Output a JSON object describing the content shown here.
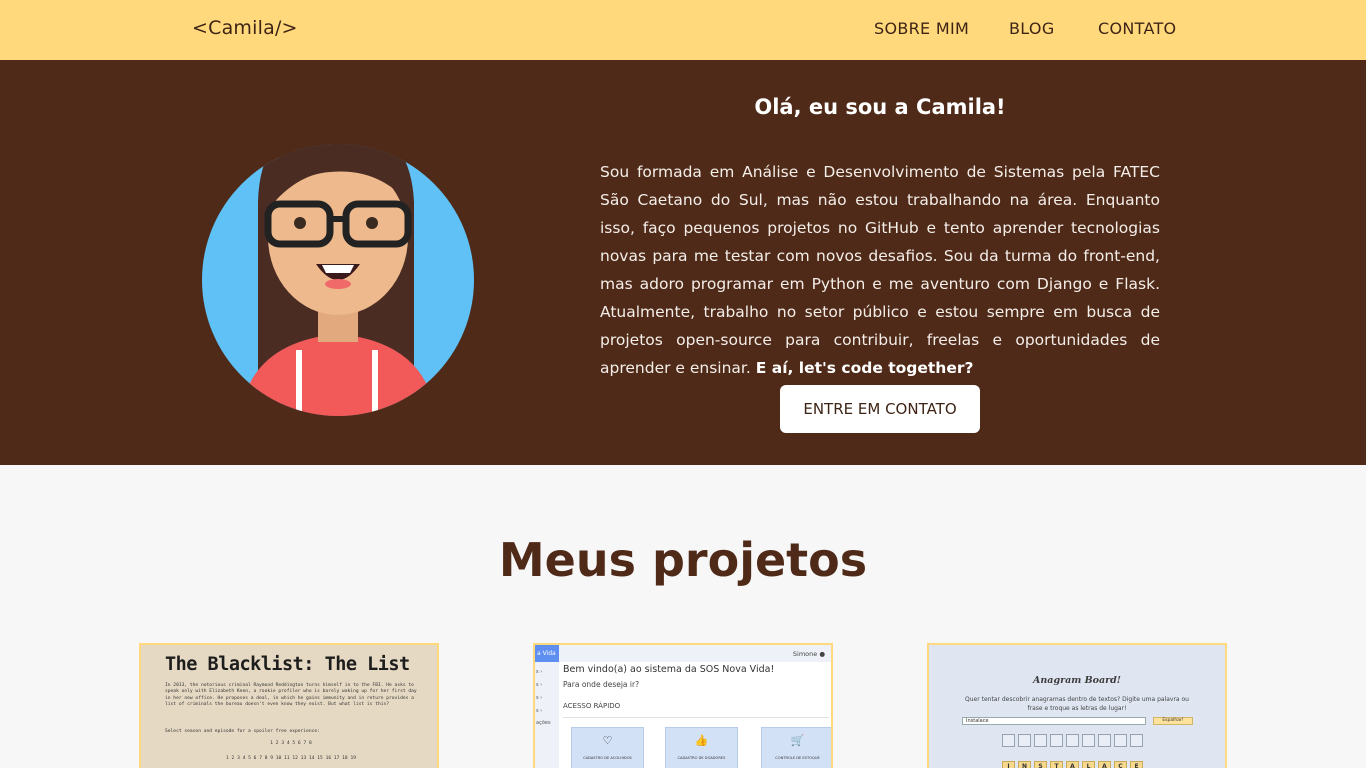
{
  "header": {
    "logo": "<Camila/>",
    "nav": [
      "SOBRE MIM",
      "BLOG",
      "CONTATO"
    ]
  },
  "hero": {
    "title": "Olá, eu sou a Camila!",
    "paragraph": "Sou formada em Análise e Desenvolvimento de Sistemas pela FATEC São Caetano do Sul, mas não estou trabalhando na área. Enquanto isso, faço pequenos projetos no GitHub e tento aprender tecnologias novas para me testar com novos desafios. Sou da turma do front-end, mas adoro programar em Python e me aventuro com Django e Flask. Atualmente, trabalho no setor público e estou sempre em busca de projetos open-source para contribuir, freelas e oportunidades de aprender e ensinar.",
    "paragraph_bold": "E aí, let's code together?",
    "cta": "ENTRE EM CONTATO"
  },
  "projects": {
    "title": "Meus projetos",
    "blacklist": {
      "title": "The Blacklist: The List",
      "text": "In 2013, the notorious criminal Raymond Reddington turns himself in to the FBI. He asks to speak only with Elizabeth Keen, a rookie profiler who is barely waking up for her first day in her new office. He proposes a deal, in which he gains immunity and in return provides a list of criminals the bureau doesn't even know they exist. But what list is this?",
      "prompt": "Select season and episode for a spoiler free experience:",
      "seasons": "1  2  3  4  5  6  7  8",
      "episodes": "1  2  3  4  5  6  7  8  9  10  11  12  13  14  15  16  17  18  19"
    },
    "sos": {
      "sidebar_head": "a Vida",
      "sidebar_items": [
        "s ›",
        "s ›",
        "s ›",
        "s ›",
        "ações"
      ],
      "user": "Simone",
      "welcome": "Bem vindo(a) ao sistema da SOS Nova Vida!",
      "ask": "Para onde deseja ir?",
      "quick": "ACESSO RÁPIDO",
      "tiles": [
        "CADASTRO DE ACOLHIDOS",
        "CADASTRO DE DOADORES",
        "CONTROLE DE ESTOQUE"
      ]
    },
    "anagram": {
      "title": "Anagram Board!",
      "desc": "Quer tentar descobrir anagramas dentro de textos? Digite uma palavra ou frase e troque as letras de lugar!",
      "input_value": "Instalace",
      "button": "Espalhar!",
      "letters": [
        "I",
        "N",
        "S",
        "T",
        "A",
        "L",
        "A",
        "C",
        "E"
      ]
    }
  }
}
